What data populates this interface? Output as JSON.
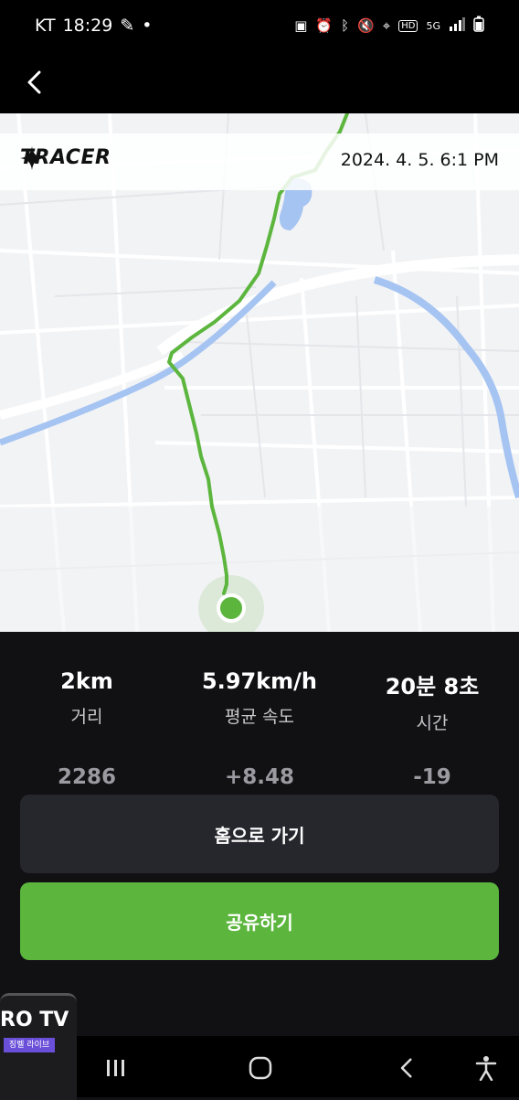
{
  "status_bar": {
    "carrier": "KT",
    "time": "18:29",
    "network": "5G"
  },
  "map": {
    "brand": "TRACER",
    "date": "2024. 4. 5. 6:1 PM",
    "route_color": "#5cb63e",
    "water_color": "#a5c4f2"
  },
  "stats": [
    {
      "value": "2km",
      "label": "거리"
    },
    {
      "value": "5.97km/h",
      "label": "평균 속도"
    },
    {
      "value": "20분 8초",
      "label": "시간"
    }
  ],
  "stats_secondary": [
    "2286",
    "+8.48",
    "-19"
  ],
  "buttons": {
    "home": "홈으로 가기",
    "share": "공유하기"
  },
  "pip": {
    "title": "RO TV",
    "subtitle": "징벨 라이브"
  },
  "colors": {
    "accent": "#5cb63e",
    "background": "#111114",
    "button_dark": "#26262d"
  }
}
